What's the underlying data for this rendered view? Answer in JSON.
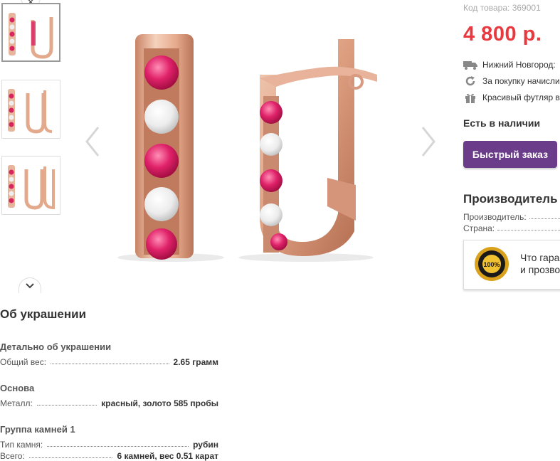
{
  "gallery": {
    "thumbnails": [
      {
        "label": "thumbnail-1",
        "active": true
      },
      {
        "label": "thumbnail-2",
        "active": false
      },
      {
        "label": "thumbnail-3",
        "active": false
      }
    ],
    "up_icon": "chevron-up-icon",
    "down_icon": "chevron-down-icon",
    "prev_icon": "chevron-left-icon",
    "next_icon": "chevron-right-icon"
  },
  "product": {
    "sku": "Код товара: 369001",
    "price": "4 800 р.",
    "info": [
      {
        "icon": "truck-icon",
        "text": "Нижний Новгород:"
      },
      {
        "icon": "refresh-icon",
        "text": "За покупку начисли"
      },
      {
        "icon": "gift-icon",
        "text": "Красивый футляр в"
      }
    ],
    "stock": "Есть в наличии",
    "quick_order": "Быстрый заказ"
  },
  "manufacturer": {
    "title": "Производитель и",
    "rows": [
      {
        "label": "Производитель:"
      },
      {
        "label": "Страна:"
      }
    ]
  },
  "guarantee": {
    "seal_icon": "guarantee-seal-icon",
    "line1": "Что гара",
    "line2": "и прозво"
  },
  "about": {
    "title": "Об украшении",
    "groups": [
      {
        "title": "Детально об украшении",
        "rows": [
          {
            "k": "Общий вес:",
            "v": "2.65 грамм"
          }
        ]
      },
      {
        "title": "Основа",
        "rows": [
          {
            "k": "Металл:",
            "v": "красный, золото 585 пробы"
          }
        ]
      },
      {
        "title": "Группа камней 1",
        "rows": [
          {
            "k": "Тип камня:",
            "v": "рубин"
          },
          {
            "k": "Всего:",
            "v": "6 камней, вес 0.51 карат"
          }
        ]
      }
    ]
  },
  "colors": {
    "price": "#e8393f",
    "button": "#6a3c8a",
    "gold": "#e2a98c",
    "ruby": "#d8245f"
  }
}
